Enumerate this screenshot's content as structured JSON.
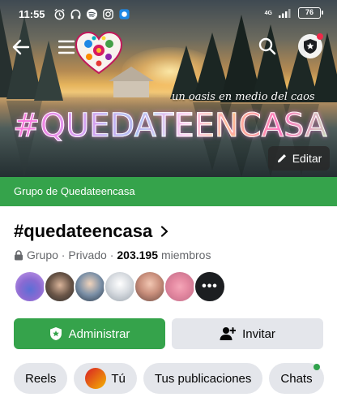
{
  "status_bar": {
    "time": "11:55",
    "network": "4G",
    "battery": "76"
  },
  "cover": {
    "slogan": "un oasis en medio del caos",
    "hashtag_art": "#QUEDATEENCASA",
    "edit_label": "Editar"
  },
  "group_strip": {
    "label": "Grupo de Quedateencasa"
  },
  "group": {
    "title": "#quedateencasa",
    "type": "Grupo · Privado · ",
    "member_count": "203.195",
    "member_suffix": "miembros"
  },
  "actions": {
    "admin_label": "Administrar",
    "invite_label": "Invitar"
  },
  "chips": [
    {
      "label": "Reels"
    },
    {
      "label": "Tú"
    },
    {
      "label": "Tus publicaciones"
    },
    {
      "label": "Chats"
    }
  ],
  "colors": {
    "brand_green": "#35a34b",
    "button_gray": "#e4e6eb",
    "notification_red": "#f02849"
  }
}
